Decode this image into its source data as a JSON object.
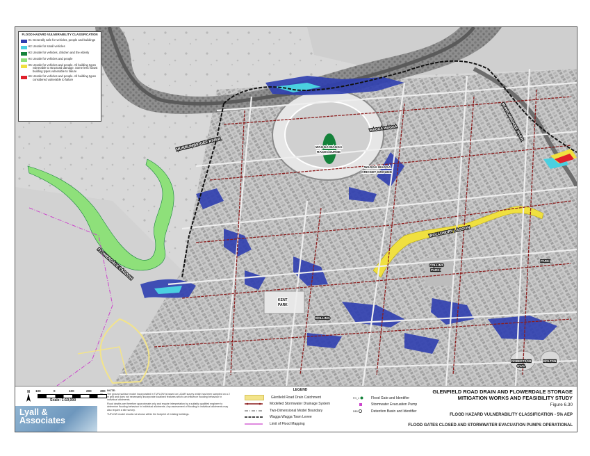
{
  "hazard_legend": {
    "title": "FLOOD HAZARD VULNERABILITY CLASSIFICATION",
    "classes": [
      {
        "code": "H1",
        "color": "#2f3fb0",
        "text": "Generally safe for vehicles, people and buildings"
      },
      {
        "code": "H2",
        "color": "#4ad0e0",
        "text": "Unsafe for small vehicles"
      },
      {
        "code": "H3",
        "color": "#14823a",
        "text": "Unsafe for vehicles, children and the elderly"
      },
      {
        "code": "H4",
        "color": "#8ee07a",
        "text": "Unsafe for vehicles and people"
      },
      {
        "code": "H5",
        "color": "#f0e040",
        "text": "Unsafe for vehicles and people. All building types vulnerable to structural damage. Some less robust building types vulnerable to failure"
      },
      {
        "code": "H6",
        "color": "#e0202a",
        "text": "Unsafe for vehicles and people. All building types considered vulnerable to failure"
      }
    ]
  },
  "map_labels": {
    "murrumbidgee": "MURRUMBIDGEE RIVER",
    "flowerdale": "FLOWERDALE LAGOON",
    "racecourse1": "WAGGA WAGGA",
    "racecourse2": "RACECOURSE",
    "cricket1": "WAGGA WAGGA",
    "cricket2": "CRICKET GROUND",
    "lagoon_road": "WAGGA WAGGA",
    "wollundry": "WOLLUNDRY LAGOON",
    "kent1": "KENT",
    "kent2": "PARK",
    "bolling": "BOLLING",
    "collins1": "COLLINS",
    "collins2": "PARK",
    "robertson1": "ROBERTSON",
    "robertson2": "OVAL",
    "bolton": "BOLTON",
    "elpark": "PARK",
    "river_ne": "MURRUMBIDGEE RIVER"
  },
  "scale": {
    "ticks": [
      "100",
      "0",
      "100",
      "200",
      "300 m"
    ],
    "caption": "Scale: 1:10,000"
  },
  "north_label": "N",
  "logo": {
    "line1": "Lyall &",
    "line2": "Associates"
  },
  "note": {
    "heading": "NOTE:",
    "p1": "The ground surface model incorporated in TUFLOW is based on LiDAR survey which has been sampled on a 2 m grid and does not necessarily incorporate localised features which can influence flooding behaviour in individual allotments.",
    "p2": "Flood depths are therefore approximate only and require interpretation by a suitably qualified engineer to determine flooding behaviour in individual allotments. Any assessment of flooding in individual allotments may also require a site survey.",
    "p3": "TUFLOW model results not shown within the footprint of existing buildings."
  },
  "legend": {
    "heading": "LEGEND",
    "items": [
      "Glenfield Road Drain Catchment",
      "Modelled Stormwater Drainage System",
      "Two-Dimensional Model Boundary",
      "Wagga Wagga Town Levee",
      "Limit of Flood Mapping"
    ],
    "items2": [
      {
        "sym": "FG_1",
        "text": "Flood Gate and Identifier"
      },
      {
        "sym": "",
        "text": "Stormwater Evacuation Pump"
      },
      {
        "sym": "DB1",
        "text": "Detention Basin and Identifier"
      }
    ]
  },
  "title": {
    "main1": "GLENFIELD ROAD DRAIN AND FLOWERDALE STORAGE",
    "main2": "MITIGATION WORKS AND FEASIBILITY STUDY",
    "figure": "Figure 6.30",
    "sub1": "FLOOD HAZARD VULNERABILITY CLASSIFICATION - 5% AEP",
    "sub2": "FLOOD GATES CLOSED AND STORMWATER EVACUATION PUMPS OPERATIONAL"
  },
  "colors": {
    "h1": "#2f3fb0",
    "h2": "#4ad0e0",
    "h3": "#14823a",
    "h4": "#8ee07a",
    "h5": "#f0e040",
    "h6": "#e0202a",
    "drainage": "#8b1d1d",
    "levee": "#111111",
    "boundary": "#cc44cc",
    "catchment": "#f3e48a"
  }
}
